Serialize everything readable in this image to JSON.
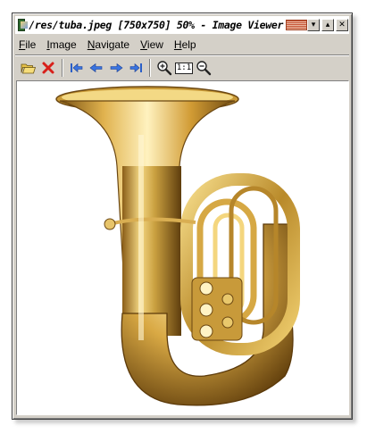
{
  "window": {
    "title": "/res/tuba.jpeg [750x750] 50% - Image Viewer",
    "buttons": {
      "minimize": "▾",
      "maximize": "▴",
      "close": "✕"
    }
  },
  "menu": [
    {
      "label": "File",
      "accel": "F",
      "rest": "ile"
    },
    {
      "label": "Image",
      "accel": "I",
      "rest": "mage"
    },
    {
      "label": "Navigate",
      "accel": "N",
      "rest": "avigate"
    },
    {
      "label": "View",
      "accel": "V",
      "rest": "iew"
    },
    {
      "label": "Help",
      "accel": "H",
      "rest": "elp"
    }
  ],
  "toolbar": {
    "items": [
      {
        "icon": "open-folder-icon"
      },
      {
        "icon": "delete-icon"
      },
      {
        "icon": "first-image-icon"
      },
      {
        "icon": "previous-image-icon"
      },
      {
        "icon": "next-image-icon"
      },
      {
        "icon": "last-image-icon"
      },
      {
        "icon": "zoom-in-icon"
      },
      {
        "icon": "actual-size-icon",
        "text": "1:1"
      },
      {
        "icon": "zoom-out-icon"
      }
    ]
  },
  "image": {
    "subject": "tuba",
    "colors": {
      "brass_light": "#f6dd8a",
      "brass_mid": "#d2a23c",
      "brass_dark": "#6e4a12"
    }
  }
}
